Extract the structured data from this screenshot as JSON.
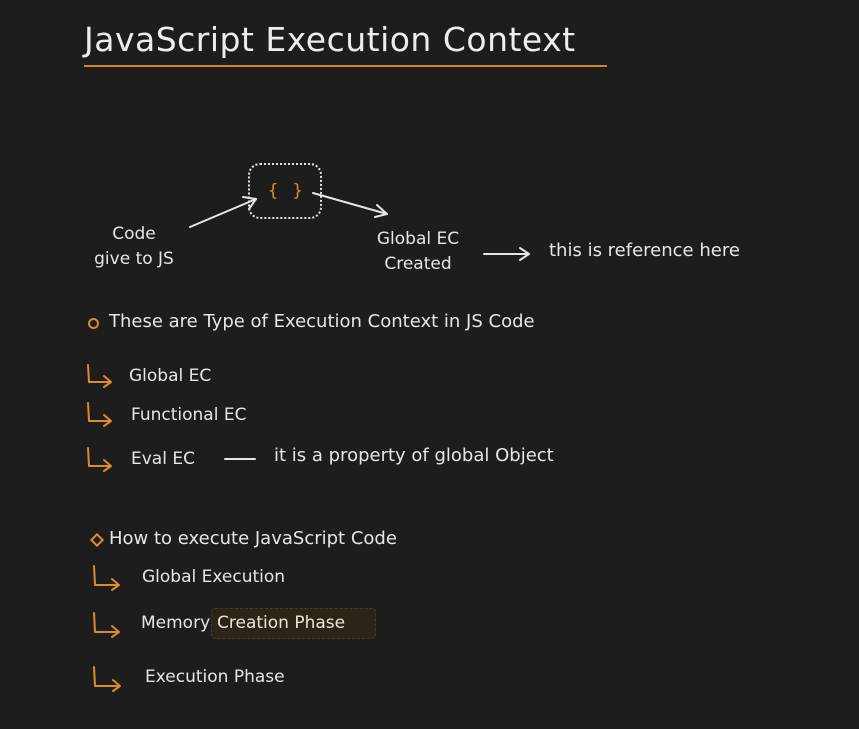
{
  "title": "JavaScript Execution Context",
  "diagram": {
    "code_box_icon": "curly-braces",
    "code_box_text": "{ }",
    "code_label_line1": "Code",
    "code_label_line2": "give to JS",
    "gec_label_line1": "Global EC",
    "gec_label_line2": "Created",
    "reference_note": "this is reference here"
  },
  "section1": {
    "heading": "These are Type of Execution Context in JS Code",
    "items": [
      {
        "label": "Global EC"
      },
      {
        "label": "Functional EC"
      },
      {
        "label": "Eval EC",
        "note": "it is a property of global Object"
      }
    ]
  },
  "section2": {
    "heading": "How to execute JavaScript Code",
    "items": [
      {
        "label": "Global Execution"
      },
      {
        "label": "Memory",
        "highlight": "Creation Phase"
      },
      {
        "label": "Execution Phase"
      }
    ]
  },
  "colors": {
    "background": "#1d1d1d",
    "accent": "#d9822b",
    "text": "#e6e6e6"
  }
}
